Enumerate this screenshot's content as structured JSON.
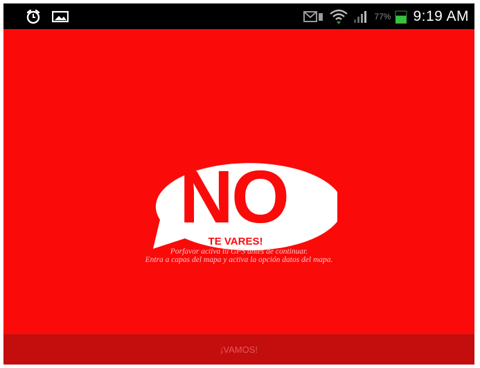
{
  "status_bar": {
    "left_icons": [
      "alarm-clock-icon",
      "image-icon"
    ],
    "right_icons": [
      "message-icon",
      "wifi-icon",
      "signal-icon",
      "battery-icon"
    ],
    "battery_percent": "77%",
    "time": "9:19 AM"
  },
  "logo": {
    "big_text": "NO",
    "small_text": "TE VARES!"
  },
  "message": {
    "line1": "Porfavor activa tu GPS antes de continuar.",
    "line2": "Entra a capas del mapa y activa la opción datos del mapa."
  },
  "bottom_button": {
    "label": "¡VAMOS!"
  },
  "colors": {
    "background": "#fb0a0a",
    "bottom_bar": "#c40d0d",
    "bubble": "#ffffff",
    "battery_fill": "#38c040"
  }
}
